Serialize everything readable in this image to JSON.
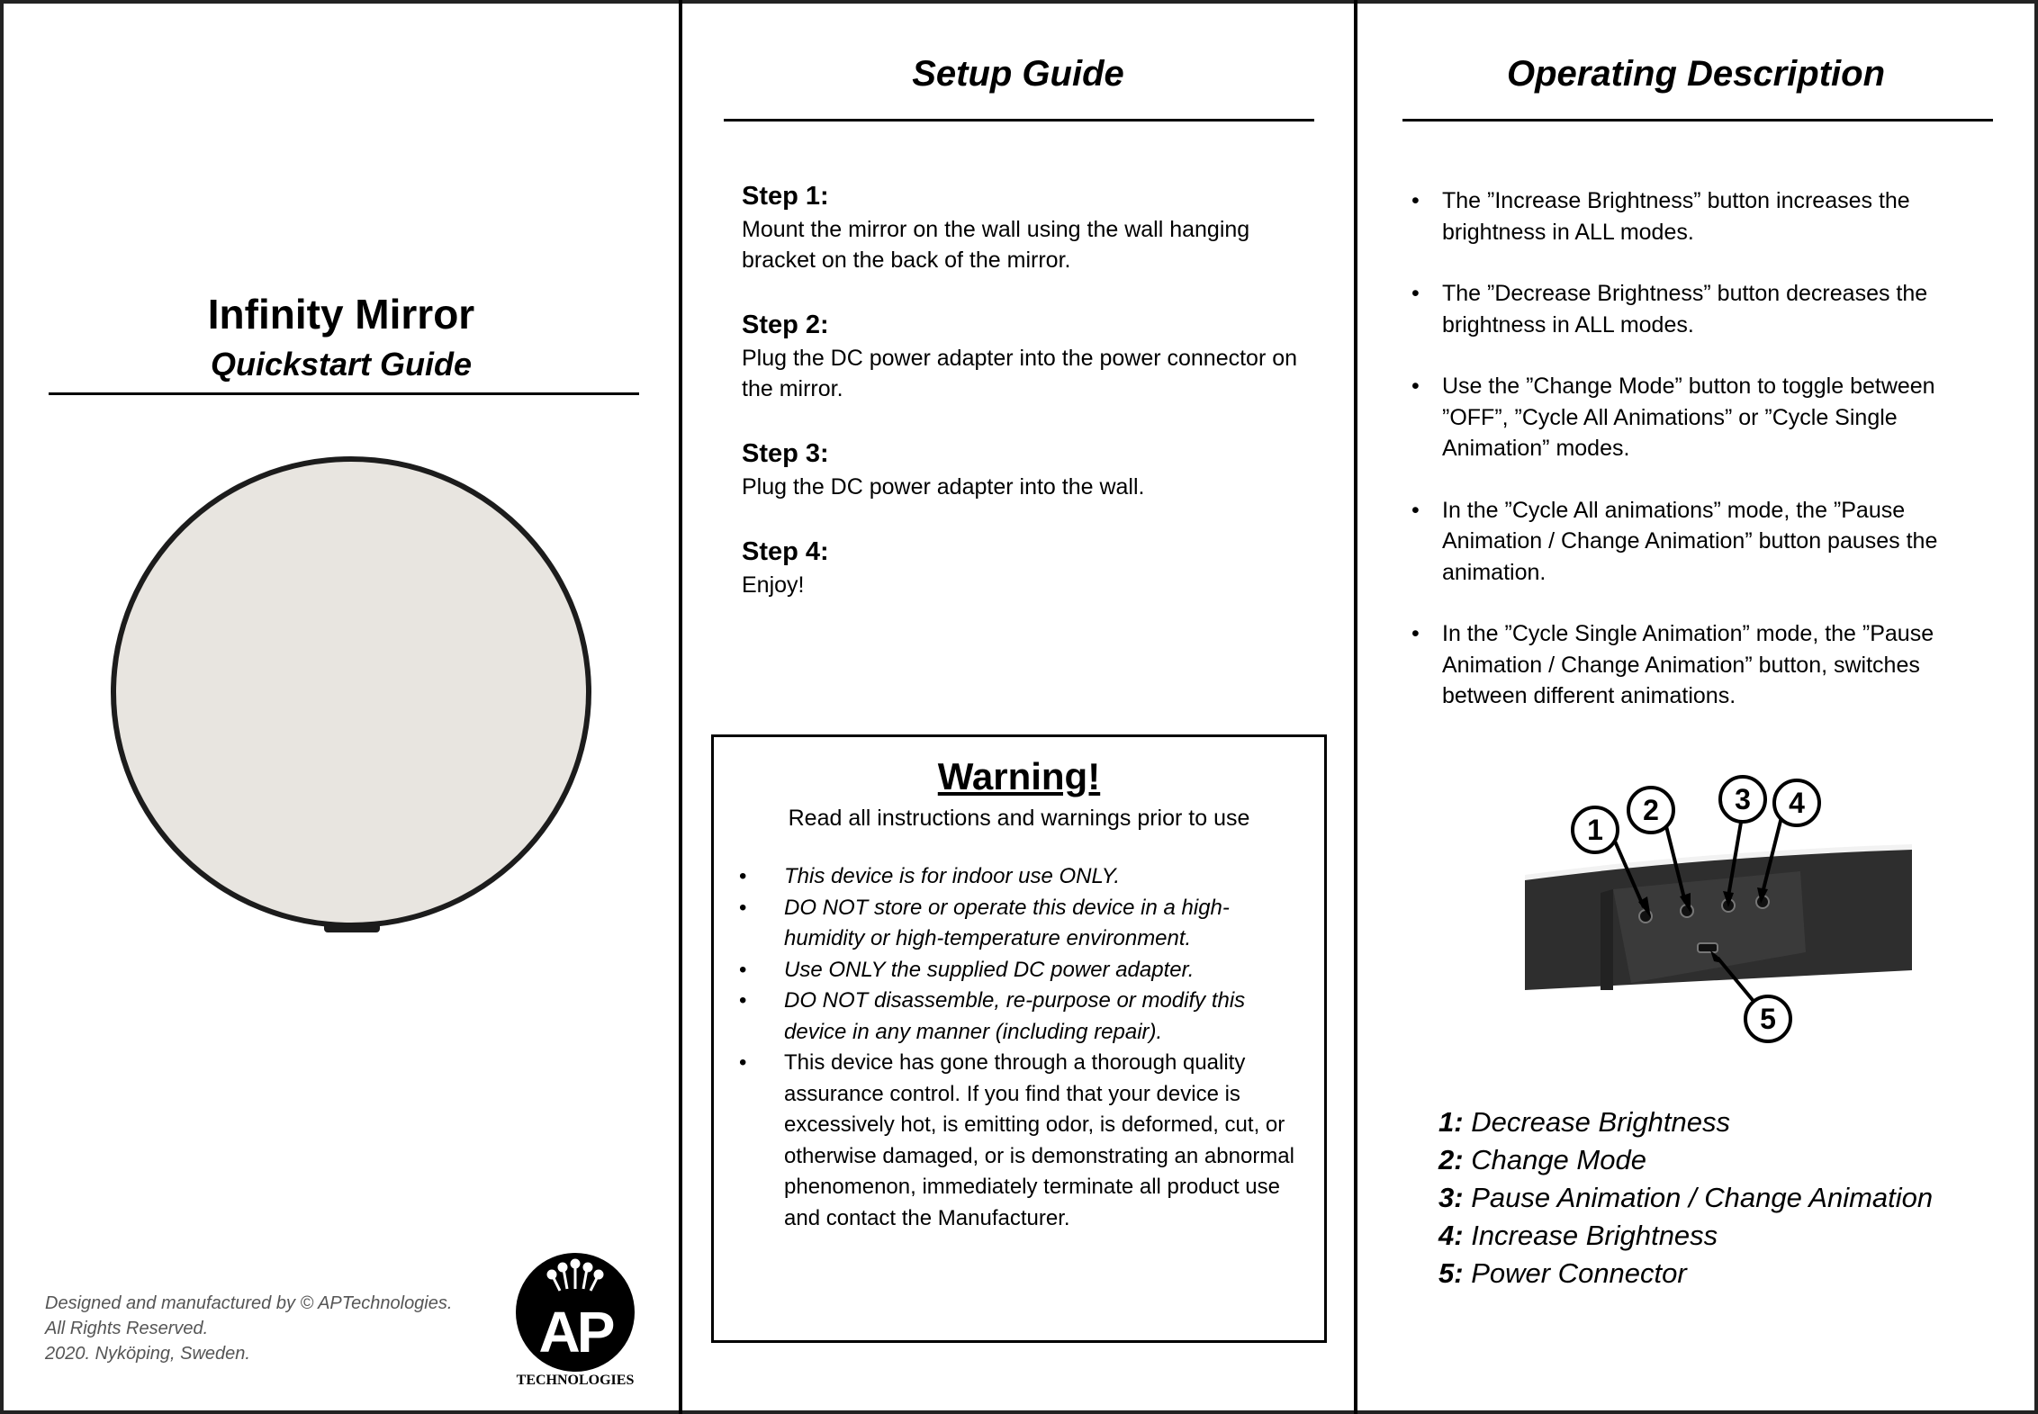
{
  "cover": {
    "title": "Infinity Mirror",
    "subtitle": "Quickstart Guide",
    "footer_lines": [
      "Designed and manufactured by © APTechnologies.",
      "All Rights Reserved.",
      "2020. Nyköping, Sweden."
    ],
    "logo": {
      "mark": "AP",
      "caption": "TECHNOLOGIES"
    }
  },
  "setup": {
    "heading": "Setup Guide",
    "steps": [
      {
        "title": "Step 1:",
        "text": "Mount the mirror on the wall using the wall hanging bracket on the back of the mirror."
      },
      {
        "title": "Step 2:",
        "text": "Plug the DC power adapter into the power connector on the mirror."
      },
      {
        "title": "Step 3:",
        "text": "Plug the DC power adapter into the wall."
      },
      {
        "title": "Step 4:",
        "text": "Enjoy!"
      }
    ]
  },
  "warning": {
    "title": "Warning!",
    "subtitle": "Read all instructions and warnings prior to use",
    "bullet": "•",
    "items": [
      "This device is for indoor use ONLY.",
      "DO NOT store or operate this device in a high-humidity or high-temperature environment.",
      "Use ONLY the supplied DC power adapter.",
      "DO NOT disassemble, re-purpose or modify this device in any manner (including repair).",
      "This device has gone through a thorough quality assurance control. If you find that your device is excessively hot, is emitting odor, is deformed, cut, or otherwise damaged, or is demonstrating an abnormal phenomenon, immediately terminate all product use and contact the Manufacturer."
    ]
  },
  "operating": {
    "heading": "Operating Description",
    "bullet": "•",
    "items": [
      "The ”Increase Brightness” button increases the brightness in ALL modes.",
      "The ”Decrease Brightness” button decreases the brightness in ALL modes.",
      "Use the ”Change Mode” button to toggle between ”OFF”, ”Cycle All Animations” or ”Cycle Single Animation” modes.",
      "In the ”Cycle All animations” mode, the ”Pause Animation / Change Animation” button pauses the animation.",
      "In the ”Cycle Single Animation” mode, the ”Pause Animation / Change Animation” button, switches between different animations."
    ],
    "callout_numbers": [
      "1",
      "2",
      "3",
      "4",
      "5"
    ],
    "legend": [
      {
        "num": "1:",
        "label": "Decrease Brightness"
      },
      {
        "num": "2:",
        "label": "Change Mode"
      },
      {
        "num": "3:",
        "label": "Pause Animation / Change Animation"
      },
      {
        "num": "4:",
        "label": "Increase Brightness"
      },
      {
        "num": "5:",
        "label": "Power Connector"
      }
    ]
  },
  "colors": {
    "mirror_face": "#e8e5e0",
    "mirror_rim": "#1c1c1c",
    "device_body": "#2e2e2e",
    "footer_text": "#555555"
  }
}
